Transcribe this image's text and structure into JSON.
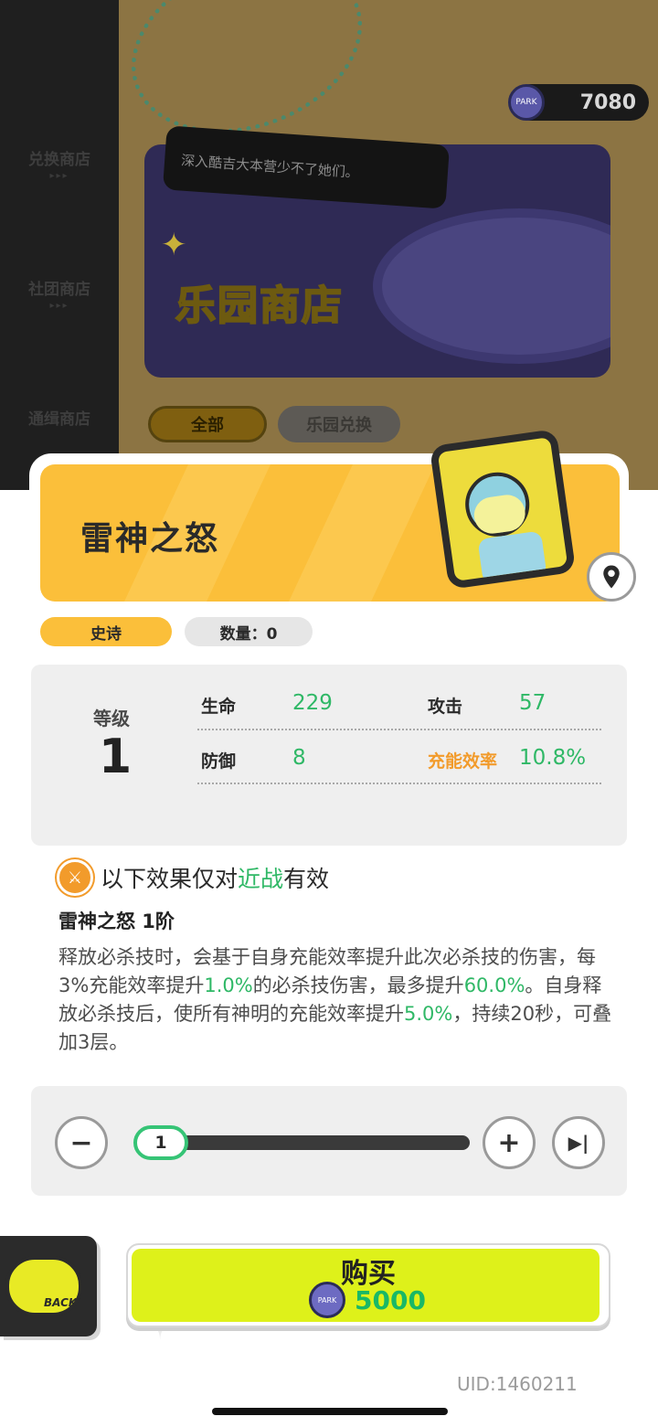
{
  "shop": {
    "sidebar": [
      "兑换商店",
      "社团商店",
      "通缉商店"
    ],
    "sidebar_arrow": "▸▸▸",
    "currency": {
      "icon": "park-coin-icon",
      "amount": "7080"
    },
    "banner_bubble": "深入酷吉大本营少不了她们。",
    "banner_title": "乐园商店",
    "tabs": [
      "全部",
      "乐园兑换"
    ]
  },
  "item": {
    "name": "雷神之怒",
    "rarity": "史诗",
    "quantity_label": "数量：0"
  },
  "stats": {
    "level_label": "等级",
    "level_value": "1",
    "hp_label": "生命",
    "hp_value": "229",
    "atk_label": "攻击",
    "atk_value": "57",
    "def_label": "防御",
    "def_value": "8",
    "energy_label": "充能效率",
    "energy_value": "10.8%"
  },
  "effect": {
    "condition_prefix": "以下效果仅对",
    "condition_highlight": "近战",
    "condition_suffix": "有效",
    "title": "雷神之怒 1阶",
    "desc_1": "释放必杀技时，会基于自身充能效率提升此次必杀技的伤害，每3%充能效率提升",
    "desc_v1": "1.0%",
    "desc_2": "的必杀技伤害，最多提升",
    "desc_v2": "60.0%",
    "desc_3": "。自身释放必杀技后，使所有神明的充能效率提升",
    "desc_v3": "5.0%",
    "desc_4": "，持续20秒，可叠加3层。"
  },
  "stepper": {
    "value": "1",
    "minus": "−",
    "plus": "+",
    "max": "▶|"
  },
  "bottom": {
    "back_label": "BACK",
    "buy_label": "购买",
    "price": "5000",
    "uid": "UID:1460211"
  },
  "colors": {
    "accent_orange": "#fbbf3a",
    "green": "#2fb866",
    "buy_yellow": "#def11a"
  }
}
